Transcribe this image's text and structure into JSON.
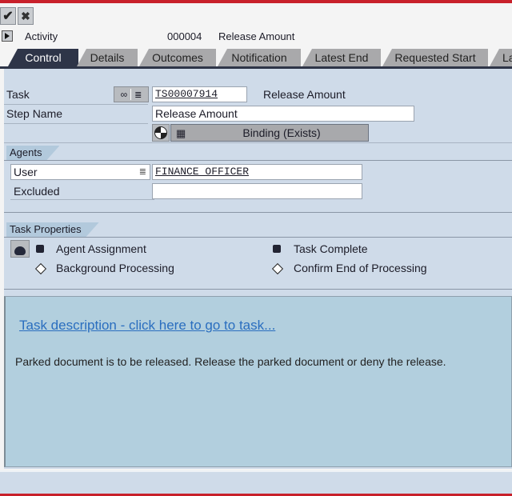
{
  "toolbar": {
    "confirm": {
      "icon": "checkmark-icon",
      "glyph": "✔"
    },
    "cancel": {
      "icon": "close-icon",
      "glyph": "✖"
    }
  },
  "header": {
    "label": "Activity",
    "number": "000004",
    "title": "Release Amount"
  },
  "tabs": [
    {
      "label": "Control",
      "active": true
    },
    {
      "label": "Details",
      "active": false
    },
    {
      "label": "Outcomes",
      "active": false
    },
    {
      "label": "Notification",
      "active": false
    },
    {
      "label": "Latest End",
      "active": false
    },
    {
      "label": "Requested Start",
      "active": false
    },
    {
      "label": "La",
      "active": false
    }
  ],
  "form": {
    "task_label": "Task",
    "task_value": "TS00007914",
    "task_description": "Release Amount",
    "step_name_label": "Step Name",
    "step_name_value": "Release Amount",
    "binding_label": "Binding (Exists)"
  },
  "agents": {
    "title": "Agents",
    "user_label": "User",
    "user_value": "FINANCE_OFFICER",
    "excluded_label": "Excluded",
    "excluded_value": ""
  },
  "task_properties": {
    "title": "Task Properties",
    "items": [
      {
        "label": "Agent Assignment",
        "state": "filled"
      },
      {
        "label": "Task Complete",
        "state": "filled"
      },
      {
        "label": "Background Processing",
        "state": "empty"
      },
      {
        "label": "Confirm End of Processing",
        "state": "empty"
      }
    ]
  },
  "description": {
    "link": "Task description - click here to go to task...",
    "text": "Parked document is to be released. Release the parked document or deny the release."
  },
  "colors": {
    "active_tab": "#2e3548",
    "inactive_tab": "#a9a9ab",
    "panel": "#cfdbe9",
    "desc_bg": "#b2cfde",
    "link": "#2a6ebf",
    "frame_red": "#c8202a"
  }
}
